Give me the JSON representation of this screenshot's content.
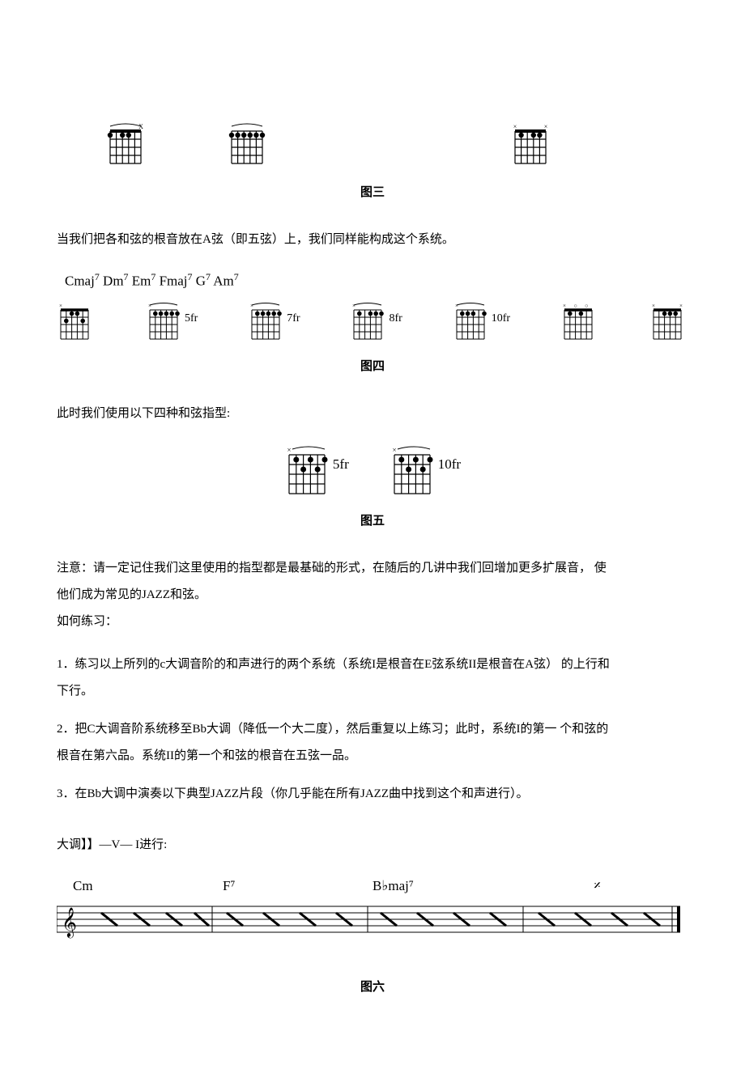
{
  "fig3": {
    "label": "图三",
    "chords": [
      {
        "name": "chord-1",
        "fret": ""
      },
      {
        "name": "chord-2",
        "fret": ""
      },
      {
        "name": "chord-3",
        "fret": ""
      }
    ]
  },
  "para1": "当我们把各和弦的根音放在A弦（即五弦）上，我们同样能构成这个系统。",
  "chordNamesLine": {
    "parts": [
      "Cmaj",
      "Dm",
      "Em",
      "Fmaj",
      "G",
      "Am"
    ],
    "sup": "7"
  },
  "fig4": {
    "label": "图四",
    "chords": [
      {
        "name": "cmaj7",
        "fret": ""
      },
      {
        "name": "dm7",
        "fret": "5fr"
      },
      {
        "name": "em7",
        "fret": "7fr"
      },
      {
        "name": "fmaj7",
        "fret": "8fr"
      },
      {
        "name": "g7",
        "fret": "10fr"
      },
      {
        "name": "am7",
        "fret": ""
      },
      {
        "name": "extra",
        "fret": ""
      }
    ]
  },
  "para2": "此时我们使用以下四种和弦指型:",
  "fig5": {
    "label": "图五",
    "chords": [
      {
        "name": "shape-1",
        "fret": "5fr"
      },
      {
        "name": "shape-2",
        "fret": "10fr"
      }
    ]
  },
  "noteBlock": {
    "line1": "注意：请一定记住我们这里使用的指型都是最基础的形式，在随后的几讲中我们回增加更多扩展音，  使",
    "line2": "他们成为常见的JAZZ和弦。",
    "line3": "如何练习："
  },
  "practice": {
    "item1a": "1．练习以上所列的c大调音阶的和声进行的两个系统（系统I是根音在E弦系统II是根音在A弦）  的上行和",
    "item1b": "下行。",
    "item2a": "2．把C大调音阶系统移至Bb大调（降低一个大二度），然后重复以上练习；此时，系统I的第一 个和弦的",
    "item2b": "根音在第六品。系统II的第一个和弦的根音在五弦一品。",
    "item3": "3．在Bb大调中演奏以下典型JAZZ片段（你几乎能在所有JAZZ曲中找到这个和声进行）。"
  },
  "progressionTitle": "大调】】—V— I进行:",
  "staff": {
    "chords": [
      "Cm",
      "F⁷",
      "B♭maj⁷",
      "𝄎"
    ]
  },
  "fig6": {
    "label": "图六"
  }
}
